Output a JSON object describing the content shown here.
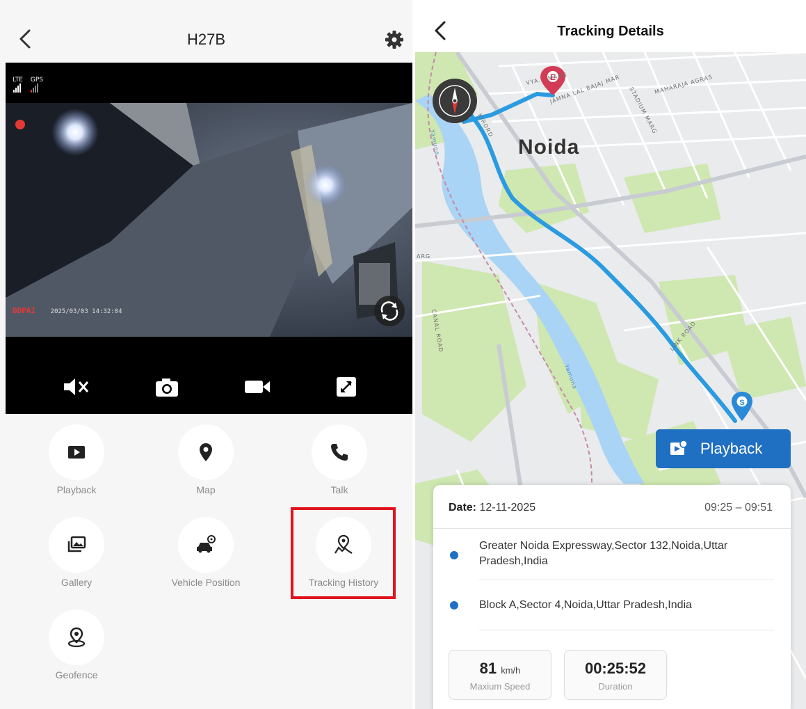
{
  "left_screen": {
    "title": "H27B",
    "video": {
      "signal_lte": "LTE",
      "signal_gps": "GPS",
      "brand": "DDPAI",
      "timestamp": "2025/03/03 14:32:04"
    },
    "controls": [
      {
        "name": "mute-button",
        "icon": "speaker-muted-icon"
      },
      {
        "name": "snapshot-button",
        "icon": "camera-icon"
      },
      {
        "name": "record-button",
        "icon": "video-camera-icon"
      },
      {
        "name": "fullscreen-button",
        "icon": "expand-icon"
      }
    ],
    "features": [
      {
        "label": "Playback",
        "icon": "play-icon"
      },
      {
        "label": "Map",
        "icon": "map-pin-icon"
      },
      {
        "label": "Talk",
        "icon": "phone-icon"
      },
      {
        "label": "Gallery",
        "icon": "gallery-icon"
      },
      {
        "label": "Vehicle Position",
        "icon": "car-icon"
      },
      {
        "label": "Tracking History",
        "icon": "route-pin-icon"
      },
      {
        "label": "Geofence",
        "icon": "geofence-icon"
      }
    ],
    "highlighted_feature": "Tracking History",
    "highlight_color": "#e0141e"
  },
  "right_screen": {
    "title": "Tracking Details",
    "map": {
      "city": "Noida",
      "road_labels": [
        "VYA... MARG",
        "JAMNA LAL BAJAJ MAR",
        "MAHARAJA AGRAS",
        "STADIUM MARG",
        "KIRORD",
        "Yamuna",
        "ARG",
        "CANAL ROAD",
        "LINK ROAD",
        "Yamuna"
      ],
      "start_marker": "S",
      "end_marker": "E",
      "route_color": "#2a9be0"
    },
    "playback_label": "Playback",
    "details": {
      "date_label": "Date:",
      "date_value": "12-11-2025",
      "time_range": "09:25 – 09:51",
      "addresses": [
        "Greater Noida Expressway,Sector 132,Noida,Uttar Pradesh,India",
        "Block A,Sector 4,Noida,Uttar Pradesh,India"
      ],
      "speed_value": "81",
      "speed_unit": "km/h",
      "speed_label": "Maxium Speed",
      "duration_value": "00:25:52",
      "duration_label": "Duration"
    },
    "accent_color": "#1f6fc2"
  }
}
